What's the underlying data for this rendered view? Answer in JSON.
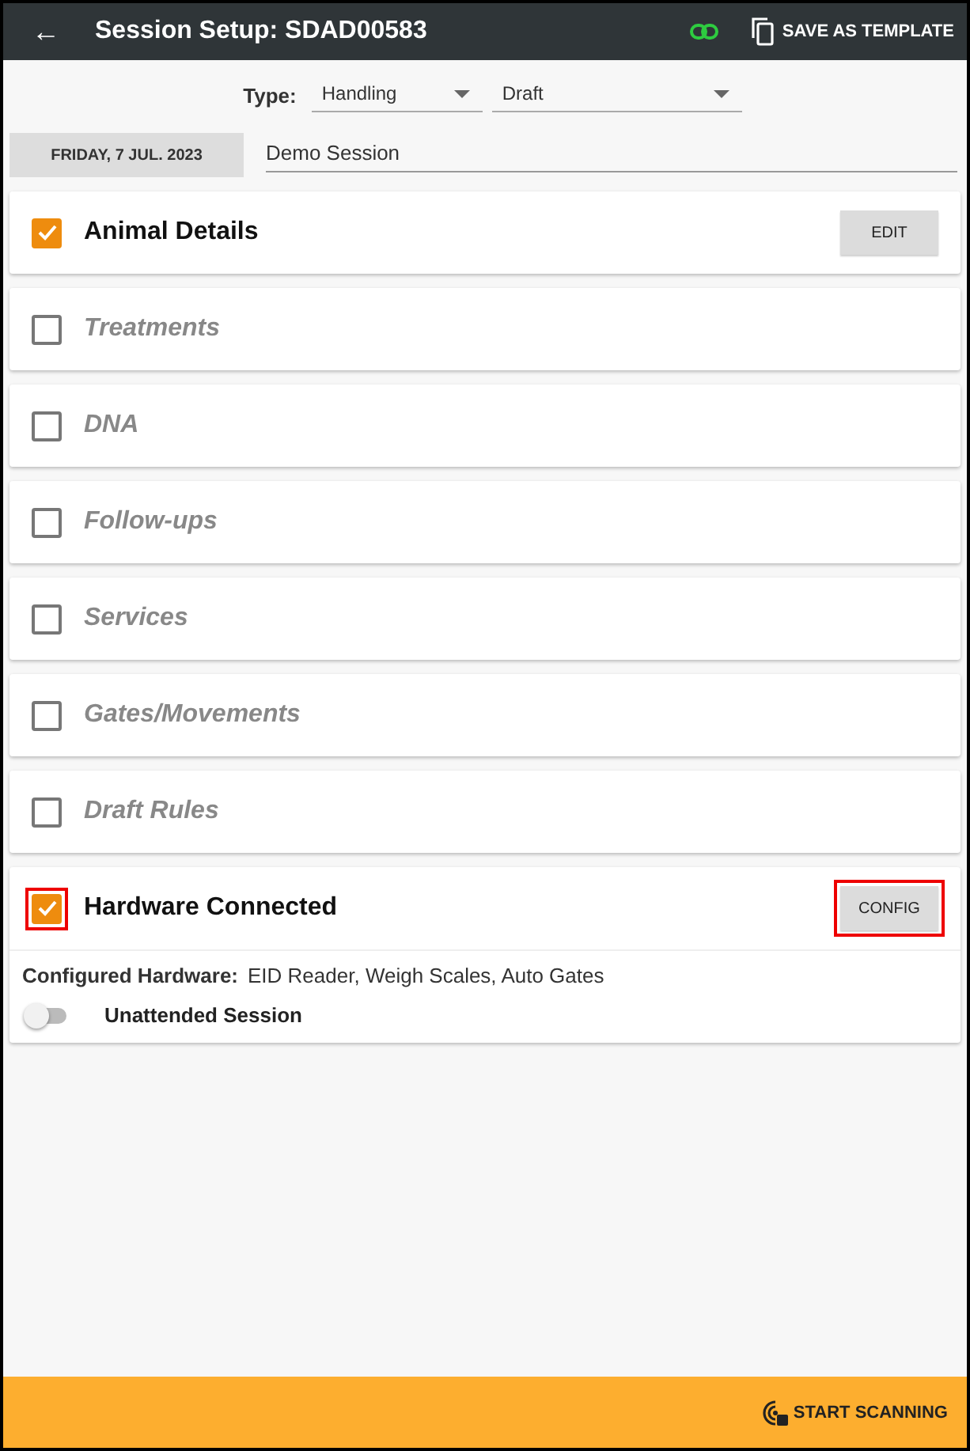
{
  "header": {
    "back": "←",
    "title": "Session Setup: SDAD00583",
    "link_connected": true,
    "save_template": "SAVE AS TEMPLATE"
  },
  "type_row": {
    "label": "Type:",
    "fields": [
      {
        "value": "Handling"
      },
      {
        "value": "Draft"
      }
    ]
  },
  "date_button": "FRIDAY, 7 JUL. 2023",
  "session_name": {
    "value": "Demo Session"
  },
  "sections": [
    {
      "label": "Animal Details",
      "checked": true,
      "button": "EDIT"
    },
    {
      "label": "Treatments",
      "checked": false
    },
    {
      "label": "DNA",
      "checked": false
    },
    {
      "label": "Follow-ups",
      "checked": false
    },
    {
      "label": "Services",
      "checked": false
    },
    {
      "label": "Gates/Movements",
      "checked": false
    },
    {
      "label": "Draft Rules",
      "checked": false
    },
    {
      "label": "Hardware Connected",
      "checked": true,
      "highlighted": true,
      "button": "CONFIG",
      "details": {
        "label": "Configured Hardware:",
        "value": "EID Reader, Weigh Scales, Auto Gates",
        "toggle": {
          "label": "Unattended Session",
          "on": false
        }
      }
    }
  ],
  "footer": {
    "start_scanning": "START SCANNING"
  }
}
